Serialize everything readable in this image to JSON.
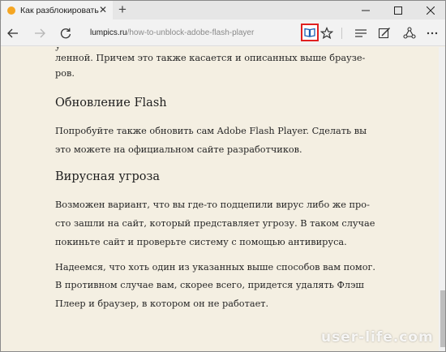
{
  "browser": {
    "tab": {
      "title": "Как разблокировать Ad",
      "close_label": "✕"
    },
    "new_tab_label": "+",
    "window_controls": {
      "minimize": "—",
      "maximize": "☐",
      "close": "✕"
    },
    "address": {
      "domain": "lumpics.ru",
      "path": "/how-to-unblock-adobe-flash-player"
    },
    "icons": {
      "back": "back-arrow-icon",
      "forward": "forward-arrow-icon",
      "refresh": "refresh-icon",
      "reading_view": "reading-view-book-icon",
      "favorites": "star-icon",
      "hub": "hub-icon",
      "web_note": "web-note-icon",
      "share": "share-icon",
      "more": "more-icon"
    },
    "colors": {
      "reading_highlight": "#e02020",
      "page_background": "#f4efe2"
    }
  },
  "article": {
    "top_line_partial": "у                                                    ",
    "para1_line1": "ленной. Причем это также касается и описанных выше браузе-",
    "para1_line2": "ров.",
    "heading1": "Обновление Flash",
    "para2_line1": "Попробуйте также обновить сам Adobe Flash Player. Сделать вы",
    "para2_line2": "это можете на официальном сайте разработчиков.",
    "heading2": "Вирусная угроза",
    "para3_line1": "Возможен вариант, что вы где-то подцепили вирус либо же про-",
    "para3_line2": "сто зашли на сайт, который представляет угрозу. В таком случае",
    "para3_line3": "покиньте сайт и проверьте систему с помощью антивируса.",
    "para4_line1": "Надеемся, что хоть один из указанных выше способов вам помог.",
    "para4_line2": "В противном случае вам, скорее всего, придется удалять Флэш",
    "para4_line3": "Плеер и браузер, в котором он не работает."
  },
  "watermark": "user-life.com"
}
